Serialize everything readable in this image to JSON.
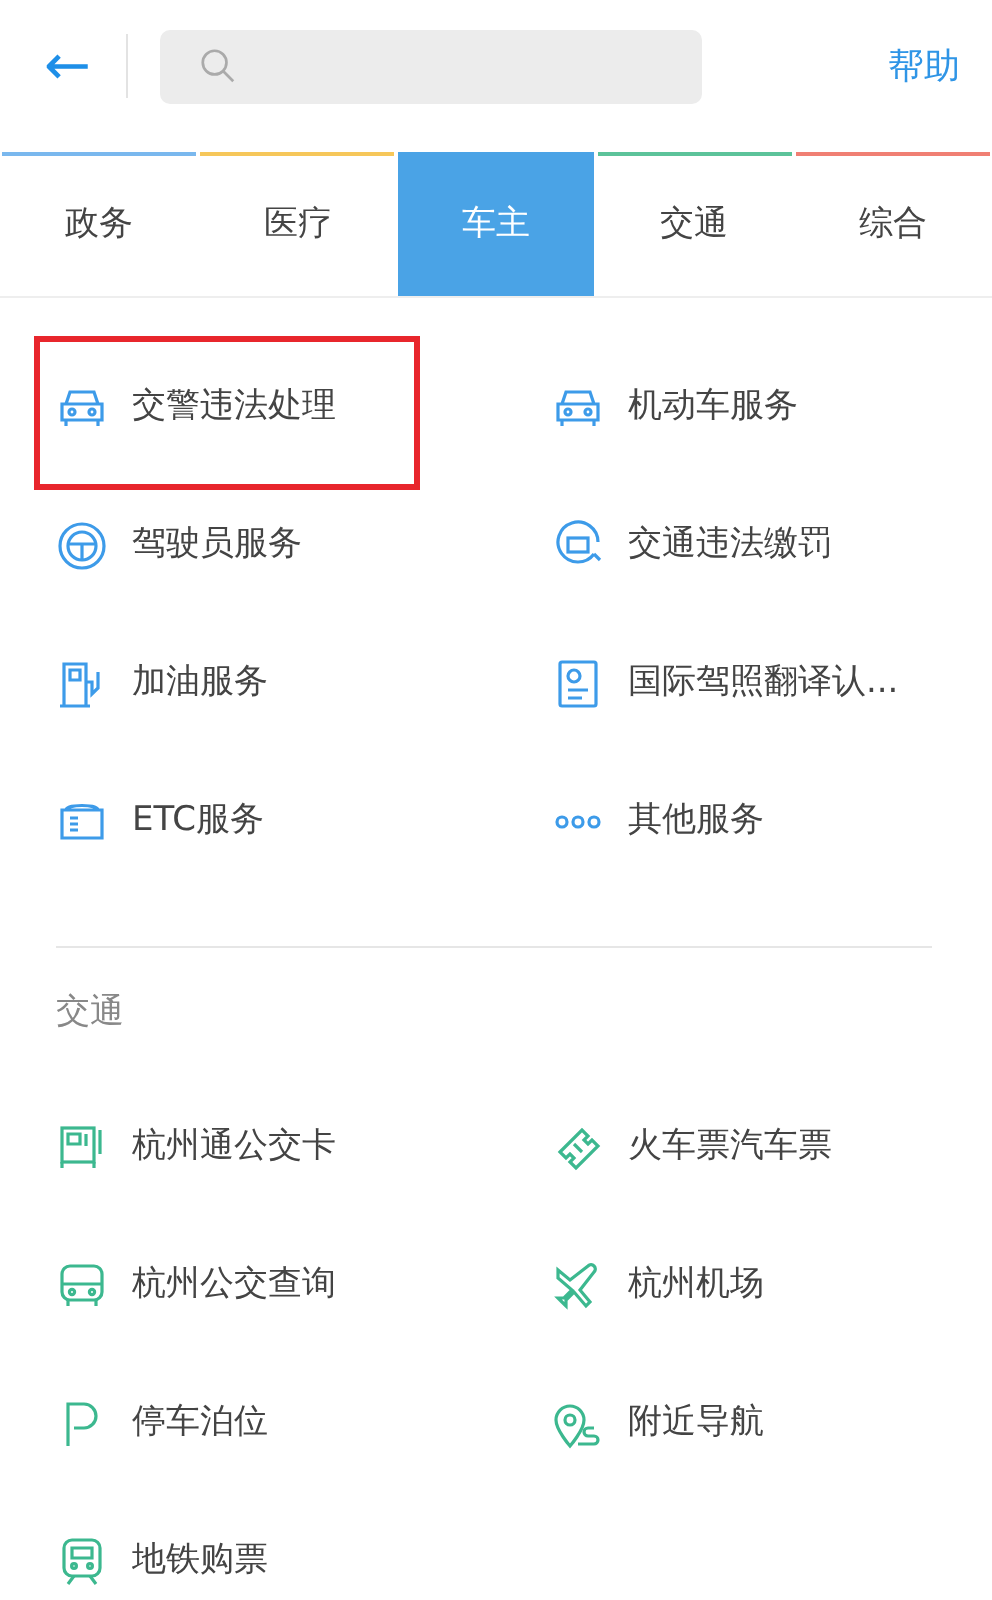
{
  "header": {
    "back": "←",
    "help": "帮助"
  },
  "tabs": [
    {
      "label": "政务",
      "selected": false,
      "color": "#7ab8ee"
    },
    {
      "label": "医疗",
      "selected": false,
      "color": "#f6c75a"
    },
    {
      "label": "车主",
      "selected": true,
      "color": "#4aa3e6"
    },
    {
      "label": "交通",
      "selected": false,
      "color": "#5cc39a"
    },
    {
      "label": "综合",
      "selected": false,
      "color": "#f07f73"
    }
  ],
  "sections": [
    {
      "items": [
        {
          "label": "交警违法处理",
          "highlighted": true
        },
        {
          "label": "机动车服务",
          "highlighted": false
        },
        {
          "label": "驾驶员服务",
          "highlighted": false
        },
        {
          "label": "交通违法缴罚",
          "highlighted": false
        },
        {
          "label": "加油服务",
          "highlighted": false
        },
        {
          "label": "国际驾照翻译认...",
          "highlighted": false
        },
        {
          "label": "ETC服务",
          "highlighted": false
        },
        {
          "label": "其他服务",
          "highlighted": false
        }
      ]
    },
    {
      "title": "交通",
      "items": [
        {
          "label": "杭州通公交卡",
          "highlighted": false
        },
        {
          "label": "火车票汽车票",
          "highlighted": false
        },
        {
          "label": "杭州公交查询",
          "highlighted": false
        },
        {
          "label": "杭州机场",
          "highlighted": false
        },
        {
          "label": "停车泊位",
          "highlighted": false
        },
        {
          "label": "附近导航",
          "highlighted": false
        },
        {
          "label": "地铁购票",
          "highlighted": false
        }
      ]
    }
  ]
}
